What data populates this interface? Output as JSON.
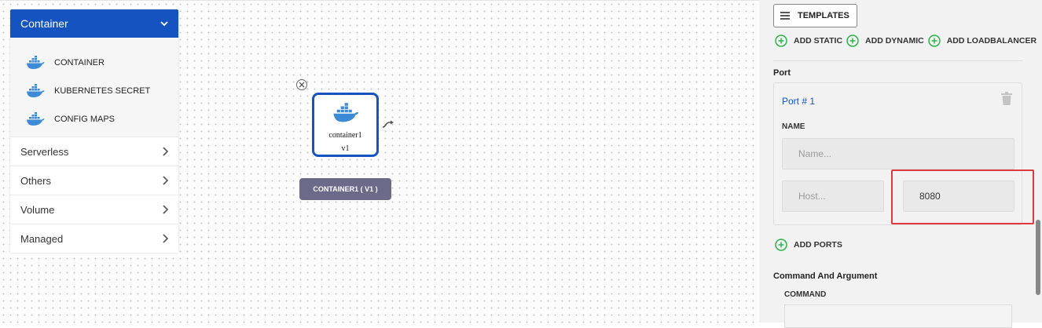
{
  "palette": {
    "header": "Container",
    "items": [
      {
        "label": "CONTAINER",
        "icon": "docker-icon"
      },
      {
        "label": "KUBERNETES SECRET",
        "icon": "docker-icon"
      },
      {
        "label": "CONFIG MAPS",
        "icon": "docker-icon"
      }
    ],
    "groups": [
      {
        "label": "Serverless"
      },
      {
        "label": "Others"
      },
      {
        "label": "Volume"
      },
      {
        "label": "Managed"
      }
    ]
  },
  "canvas": {
    "node": {
      "name": "container1",
      "version": "v1",
      "label": "CONTAINER1 ( V1 )"
    }
  },
  "panel": {
    "templates_label": "TEMPLATES",
    "add_static": "ADD STATIC",
    "add_dynamic": "ADD DYNAMIC",
    "add_loadbalancer": "ADD LOADBALANCER",
    "port_section": "Port",
    "port_card": {
      "title": "Port # 1",
      "name_label": "NAME",
      "name_placeholder": "Name...",
      "host_placeholder": "Host...",
      "port_value": "8080"
    },
    "add_ports": "ADD PORTS",
    "command_section": "Command And Argument",
    "command_label": "COMMAND"
  },
  "colors": {
    "accent": "#1554c0",
    "success": "#2cb34a",
    "highlight": "#e0393e",
    "node_label_bg": "#6b6a88"
  }
}
